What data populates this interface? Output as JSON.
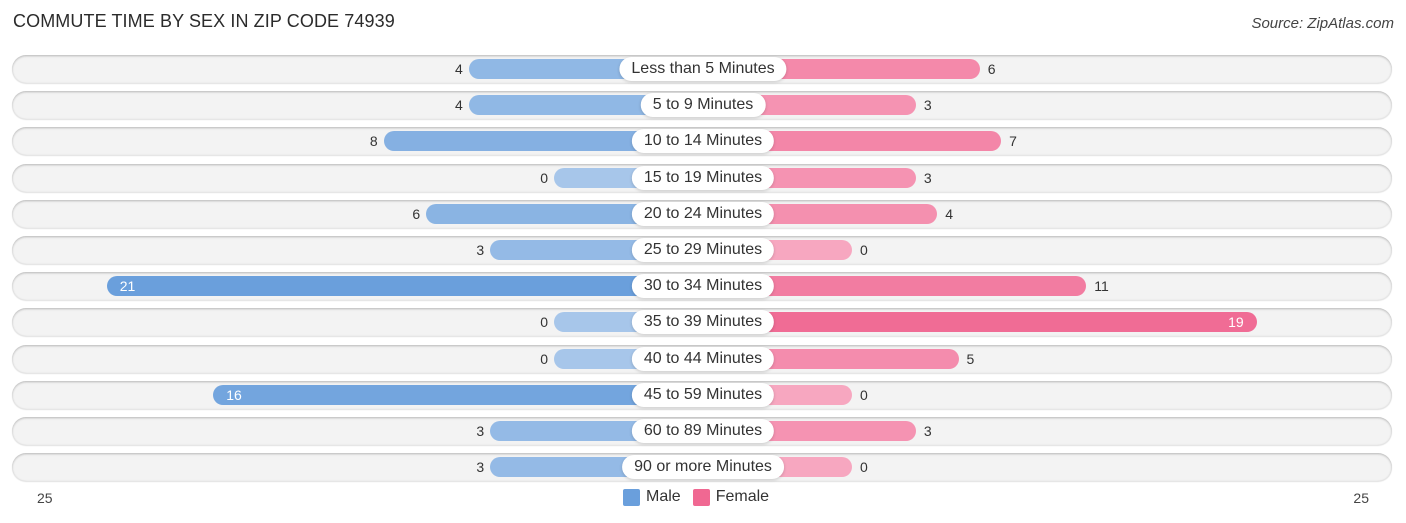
{
  "header": {
    "title": "COMMUTE TIME BY SEX IN ZIP CODE 74939",
    "source": "Source: ZipAtlas.com"
  },
  "colors": {
    "male": "#6a9fdc",
    "male_light": "#a7c6ea",
    "female": "#f06892",
    "female_light": "#f7a7c0",
    "row_bg": "#f3f3f3"
  },
  "chart_data": {
    "type": "bar",
    "orientation": "horizontal-diverging",
    "title": "COMMUTE TIME BY SEX IN ZIP CODE 74939",
    "categories": [
      "Less than 5 Minutes",
      "5 to 9 Minutes",
      "10 to 14 Minutes",
      "15 to 19 Minutes",
      "20 to 24 Minutes",
      "25 to 29 Minutes",
      "30 to 34 Minutes",
      "35 to 39 Minutes",
      "40 to 44 Minutes",
      "45 to 59 Minutes",
      "60 to 89 Minutes",
      "90 or more Minutes"
    ],
    "series": [
      {
        "name": "Male",
        "values": [
          4,
          4,
          8,
          0,
          6,
          3,
          21,
          0,
          0,
          16,
          3,
          3
        ]
      },
      {
        "name": "Female",
        "values": [
          6,
          3,
          7,
          3,
          4,
          0,
          11,
          19,
          5,
          0,
          3,
          0
        ]
      }
    ],
    "axis": {
      "left_label": "25",
      "right_label": "25",
      "max": 25
    },
    "legend": {
      "position": "bottom-center",
      "entries": [
        "Male",
        "Female"
      ]
    }
  }
}
